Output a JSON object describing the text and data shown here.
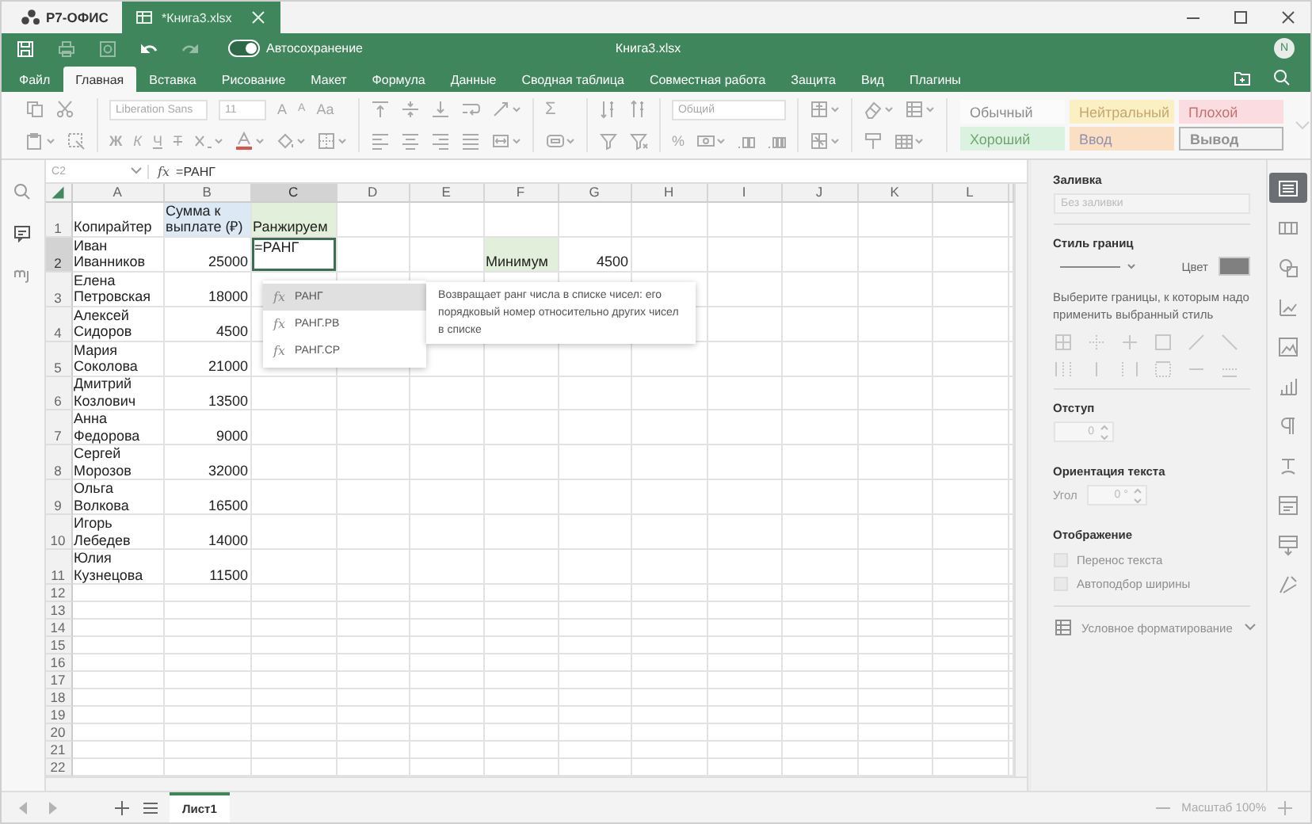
{
  "app": {
    "name": "Р7-ОФИС"
  },
  "document_tab": {
    "title": "*Книга3.xlsx",
    "selected": true
  },
  "quick_access": {
    "autosave_label": "Автосохранение",
    "autosave_on": true
  },
  "window": {
    "title": "Книга3.xlsx"
  },
  "user": {
    "initial": "N"
  },
  "menu_tabs": [
    {
      "label": "Файл",
      "selected": false
    },
    {
      "label": "Главная",
      "selected": true
    },
    {
      "label": "Вставка",
      "selected": false
    },
    {
      "label": "Рисование",
      "selected": false
    },
    {
      "label": "Макет",
      "selected": false
    },
    {
      "label": "Формула",
      "selected": false
    },
    {
      "label": "Данные",
      "selected": false
    },
    {
      "label": "Сводная таблица",
      "selected": false
    },
    {
      "label": "Совместная работа",
      "selected": false
    },
    {
      "label": "Защита",
      "selected": false
    },
    {
      "label": "Вид",
      "selected": false
    },
    {
      "label": "Плагины",
      "selected": false
    }
  ],
  "toolbar": {
    "disabled": true,
    "font_name": "Liberation Sans",
    "font_size": "11",
    "font_size_buttons": [
      {
        "label": "A",
        "kind": "grow"
      },
      {
        "label": "A",
        "kind": "shrink"
      },
      {
        "label": "Aa",
        "kind": "case"
      }
    ],
    "format_buttons": [
      {
        "label": "Ж",
        "kind": "bold"
      },
      {
        "label": "К",
        "kind": "italic"
      },
      {
        "label": "Ч",
        "kind": "underline"
      },
      {
        "label": "Т",
        "kind": "strike"
      }
    ],
    "sum_label": "Σ",
    "number_format": "Общий",
    "percent_label": "%",
    "cell_styles": [
      {
        "label": "Обычный",
        "kind": "normal"
      },
      {
        "label": "Нейтральный",
        "kind": "neutral"
      },
      {
        "label": "Плохой",
        "kind": "bad"
      },
      {
        "label": "Хороший",
        "kind": "good"
      },
      {
        "label": "Ввод",
        "kind": "input"
      },
      {
        "label": "Вывод",
        "kind": "output"
      }
    ]
  },
  "formula_bar": {
    "cell_ref": "C2",
    "fx_label": "fx",
    "formula": "=РАНГ"
  },
  "sheet": {
    "columns": [
      {
        "label": "A",
        "selected": false
      },
      {
        "label": "B",
        "selected": false
      },
      {
        "label": "C",
        "selected": true
      },
      {
        "label": "D",
        "selected": false
      },
      {
        "label": "E",
        "selected": false
      },
      {
        "label": "F",
        "selected": false
      },
      {
        "label": "G",
        "selected": false
      },
      {
        "label": "H",
        "selected": false
      },
      {
        "label": "I",
        "selected": false
      },
      {
        "label": "J",
        "selected": false
      },
      {
        "label": "K",
        "selected": false
      },
      {
        "label": "L",
        "selected": false
      }
    ],
    "rows": [
      {
        "number": "1",
        "selected": false,
        "cells": {
          "A": {
            "text": "Копирайтер",
            "kind": "text",
            "selected": false
          },
          "B": {
            "text": "Сумма к выплате (₽)",
            "kind": "text",
            "selected": false,
            "color": "#dce9f5"
          },
          "C": {
            "text": "Ранжируем",
            "kind": "text",
            "selected": false,
            "color": "#e2efda"
          }
        }
      },
      {
        "number": "2",
        "selected": true,
        "cells": {
          "A": {
            "text": "Иван Иванников",
            "kind": "text",
            "selected": false
          },
          "B": {
            "text": "25000",
            "kind": "number",
            "selected": false
          },
          "C": {
            "text": "=РАНГ",
            "kind": "text",
            "selected": true
          },
          "F": {
            "text": "Минимум",
            "kind": "text",
            "selected": false,
            "color": "#e2efda"
          },
          "G": {
            "text": "4500",
            "kind": "number",
            "selected": false
          }
        }
      },
      {
        "number": "3",
        "selected": false,
        "cells": {
          "A": {
            "text": "Елена Петровская",
            "kind": "text",
            "selected": false
          },
          "B": {
            "text": "18000",
            "kind": "number",
            "selected": false
          }
        }
      },
      {
        "number": "4",
        "selected": false,
        "cells": {
          "A": {
            "text": "Алексей Сидоров",
            "kind": "text",
            "selected": false
          },
          "B": {
            "text": "4500",
            "kind": "number",
            "selected": false
          }
        }
      },
      {
        "number": "5",
        "selected": false,
        "cells": {
          "A": {
            "text": "Мария Соколова",
            "kind": "text",
            "selected": false
          },
          "B": {
            "text": "21000",
            "kind": "number",
            "selected": false
          }
        }
      },
      {
        "number": "6",
        "selected": false,
        "cells": {
          "A": {
            "text": "Дмитрий Козлович",
            "kind": "text",
            "selected": false
          },
          "B": {
            "text": "13500",
            "kind": "number",
            "selected": false
          }
        }
      },
      {
        "number": "7",
        "selected": false,
        "cells": {
          "A": {
            "text": "Анна Федорова",
            "kind": "text",
            "selected": false
          },
          "B": {
            "text": "9000",
            "kind": "number",
            "selected": false
          }
        }
      },
      {
        "number": "8",
        "selected": false,
        "cells": {
          "A": {
            "text": "Сергей Морозов",
            "kind": "text",
            "selected": false
          },
          "B": {
            "text": "32000",
            "kind": "number",
            "selected": false
          }
        }
      },
      {
        "number": "9",
        "selected": false,
        "cells": {
          "A": {
            "text": "Ольга Волкова",
            "kind": "text",
            "selected": false
          },
          "B": {
            "text": "16500",
            "kind": "number",
            "selected": false
          }
        }
      },
      {
        "number": "10",
        "selected": false,
        "cells": {
          "A": {
            "text": "Игорь Лебедев",
            "kind": "text",
            "selected": false
          },
          "B": {
            "text": "14000",
            "kind": "number",
            "selected": false
          }
        }
      },
      {
        "number": "11",
        "selected": false,
        "cells": {
          "A": {
            "text": "Юлия Кузнецова",
            "kind": "text",
            "selected": false
          },
          "B": {
            "text": "11500",
            "kind": "number",
            "selected": false
          }
        }
      },
      {
        "number": "12",
        "selected": false
      },
      {
        "number": "13",
        "selected": false
      },
      {
        "number": "14",
        "selected": false
      },
      {
        "number": "15",
        "selected": false
      },
      {
        "number": "16",
        "selected": false
      },
      {
        "number": "17",
        "selected": false
      },
      {
        "number": "18",
        "selected": false
      },
      {
        "number": "19",
        "selected": false
      },
      {
        "number": "20",
        "selected": false
      },
      {
        "number": "21",
        "selected": false
      },
      {
        "number": "22",
        "selected": false
      }
    ]
  },
  "autocomplete": {
    "items": [
      {
        "icon": "fx",
        "name": "РАНГ",
        "selected": true
      },
      {
        "icon": "fx",
        "name": "РАНГ.РВ",
        "selected": false
      },
      {
        "icon": "fx",
        "name": "РАНГ.СР",
        "selected": false
      }
    ],
    "tooltip": "Возвращает ранг числа в списке чисел: его порядковый номер относительно других чисел в списке"
  },
  "panel": {
    "fill_heading": "Заливка",
    "fill_value": "Без заливки",
    "border_heading": "Стиль границ",
    "color_label": "Цвет",
    "border_hint": "Выберите границы, к которым надо применить выбранный стиль",
    "indent_heading": "Отступ",
    "indent_value": "0",
    "orientation_heading": "Ориентация текста",
    "angle_label": "Угол",
    "angle_value": "0 °",
    "display_heading": "Отображение",
    "options": [
      {
        "label": "Перенос текста",
        "checked": false,
        "disabled": true
      },
      {
        "label": "Автоподбор ширины",
        "checked": false,
        "disabled": true
      }
    ],
    "conditional_label": "Условное форматирование"
  },
  "right_toolbar": [
    {
      "selected": true
    },
    {
      "selected": false
    },
    {
      "selected": false
    },
    {
      "selected": false
    },
    {
      "selected": false
    },
    {
      "selected": false
    },
    {
      "selected": false
    },
    {
      "selected": false
    },
    {
      "selected": false
    },
    {
      "selected": false
    },
    {
      "selected": false
    }
  ],
  "sheet_tabs": [
    {
      "label": "Лист1",
      "selected": true
    }
  ],
  "status": {
    "zoom_label": "Масштаб 100%"
  }
}
